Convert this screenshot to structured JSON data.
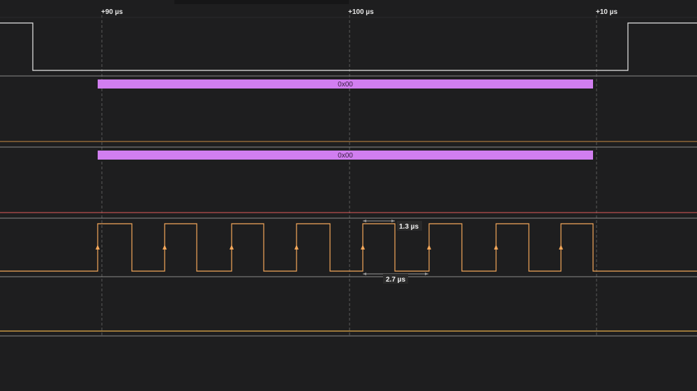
{
  "timeline": {
    "ticks": [
      {
        "label": "+90 µs",
        "t": 90
      },
      {
        "label": "+100 µs",
        "t": 100
      },
      {
        "label": "+10 µs",
        "t": 110
      }
    ]
  },
  "colors": {
    "background": "#1e1e1f",
    "channel_divider": "#8a8a8a",
    "grid": "#5a5a5a",
    "enable_signal": "#e8e8e8",
    "bus_frame": "#d17ef0",
    "bus_text": "#3a1f44",
    "clock": "#f5a85a",
    "clock_edge_marker": "#f5a85a",
    "clock_channel_top_line": "#e05a5a",
    "data_channel_line": "#e8b04a",
    "measurement": "#9a9a9a",
    "measurement_label_bg": "#2a2a2a"
  },
  "channels": [
    {
      "id": "enable",
      "kind": "digital",
      "levels": [
        1,
        0,
        1
      ]
    },
    {
      "id": "mosi",
      "kind": "bus",
      "frames": [
        {
          "value": "0x00"
        }
      ]
    },
    {
      "id": "miso",
      "kind": "bus",
      "frames": [
        {
          "value": "0x00"
        }
      ]
    },
    {
      "id": "clock",
      "kind": "clock",
      "pulses": 8,
      "edge_markers": 8
    },
    {
      "id": "data",
      "kind": "digital",
      "levels": [
        0
      ]
    }
  ],
  "measurements": [
    {
      "id": "high-width",
      "label": "1.3 µs"
    },
    {
      "id": "period",
      "label": "2.7 µs"
    }
  ]
}
